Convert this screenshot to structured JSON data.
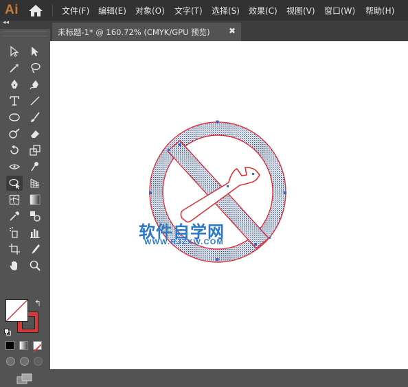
{
  "app": {
    "logo": "Ai"
  },
  "menu": {
    "items": [
      "文件(F)",
      "编辑(E)",
      "对象(O)",
      "文字(T)",
      "选择(S)",
      "效果(C)",
      "视图(V)",
      "窗口(W)",
      "帮助(H)"
    ]
  },
  "panel": {
    "collapse": "◂◂"
  },
  "document": {
    "tab_title": "未标题-1* @ 160.72% (CMYK/GPU 预览)",
    "close": "✖"
  },
  "toolbar": {
    "tools": [
      "selection-tool",
      "direct-selection-tool",
      "magic-wand-tool",
      "lasso-tool",
      "pen-tool",
      "curvature-tool",
      "type-tool",
      "line-segment-tool",
      "ellipse-tool",
      "paintbrush-tool",
      "shaper-tool",
      "eraser-tool",
      "rotate-tool",
      "scale-tool",
      "width-tool",
      "puppet-warp-tool",
      "shape-builder-tool",
      "perspective-grid-tool",
      "mesh-tool",
      "gradient-tool",
      "eyedropper-tool",
      "blend-tool",
      "symbol-sprayer-tool",
      "column-graph-tool",
      "artboard-tool",
      "slice-tool",
      "hand-tool",
      "zoom-tool"
    ],
    "active_tool": "shape-builder-tool",
    "swap_label": "↰",
    "fill_color": "#ffffff",
    "stroke_color": "#d33b3b"
  },
  "artwork": {
    "stroke_color": "#e0313a",
    "pattern_color": "#3e5c9a",
    "anchor_color": "#3c5fd0"
  },
  "watermark": {
    "title": "软件自学网",
    "url": "WWW.RJZXW.COM",
    "color": "#2c78c8"
  }
}
